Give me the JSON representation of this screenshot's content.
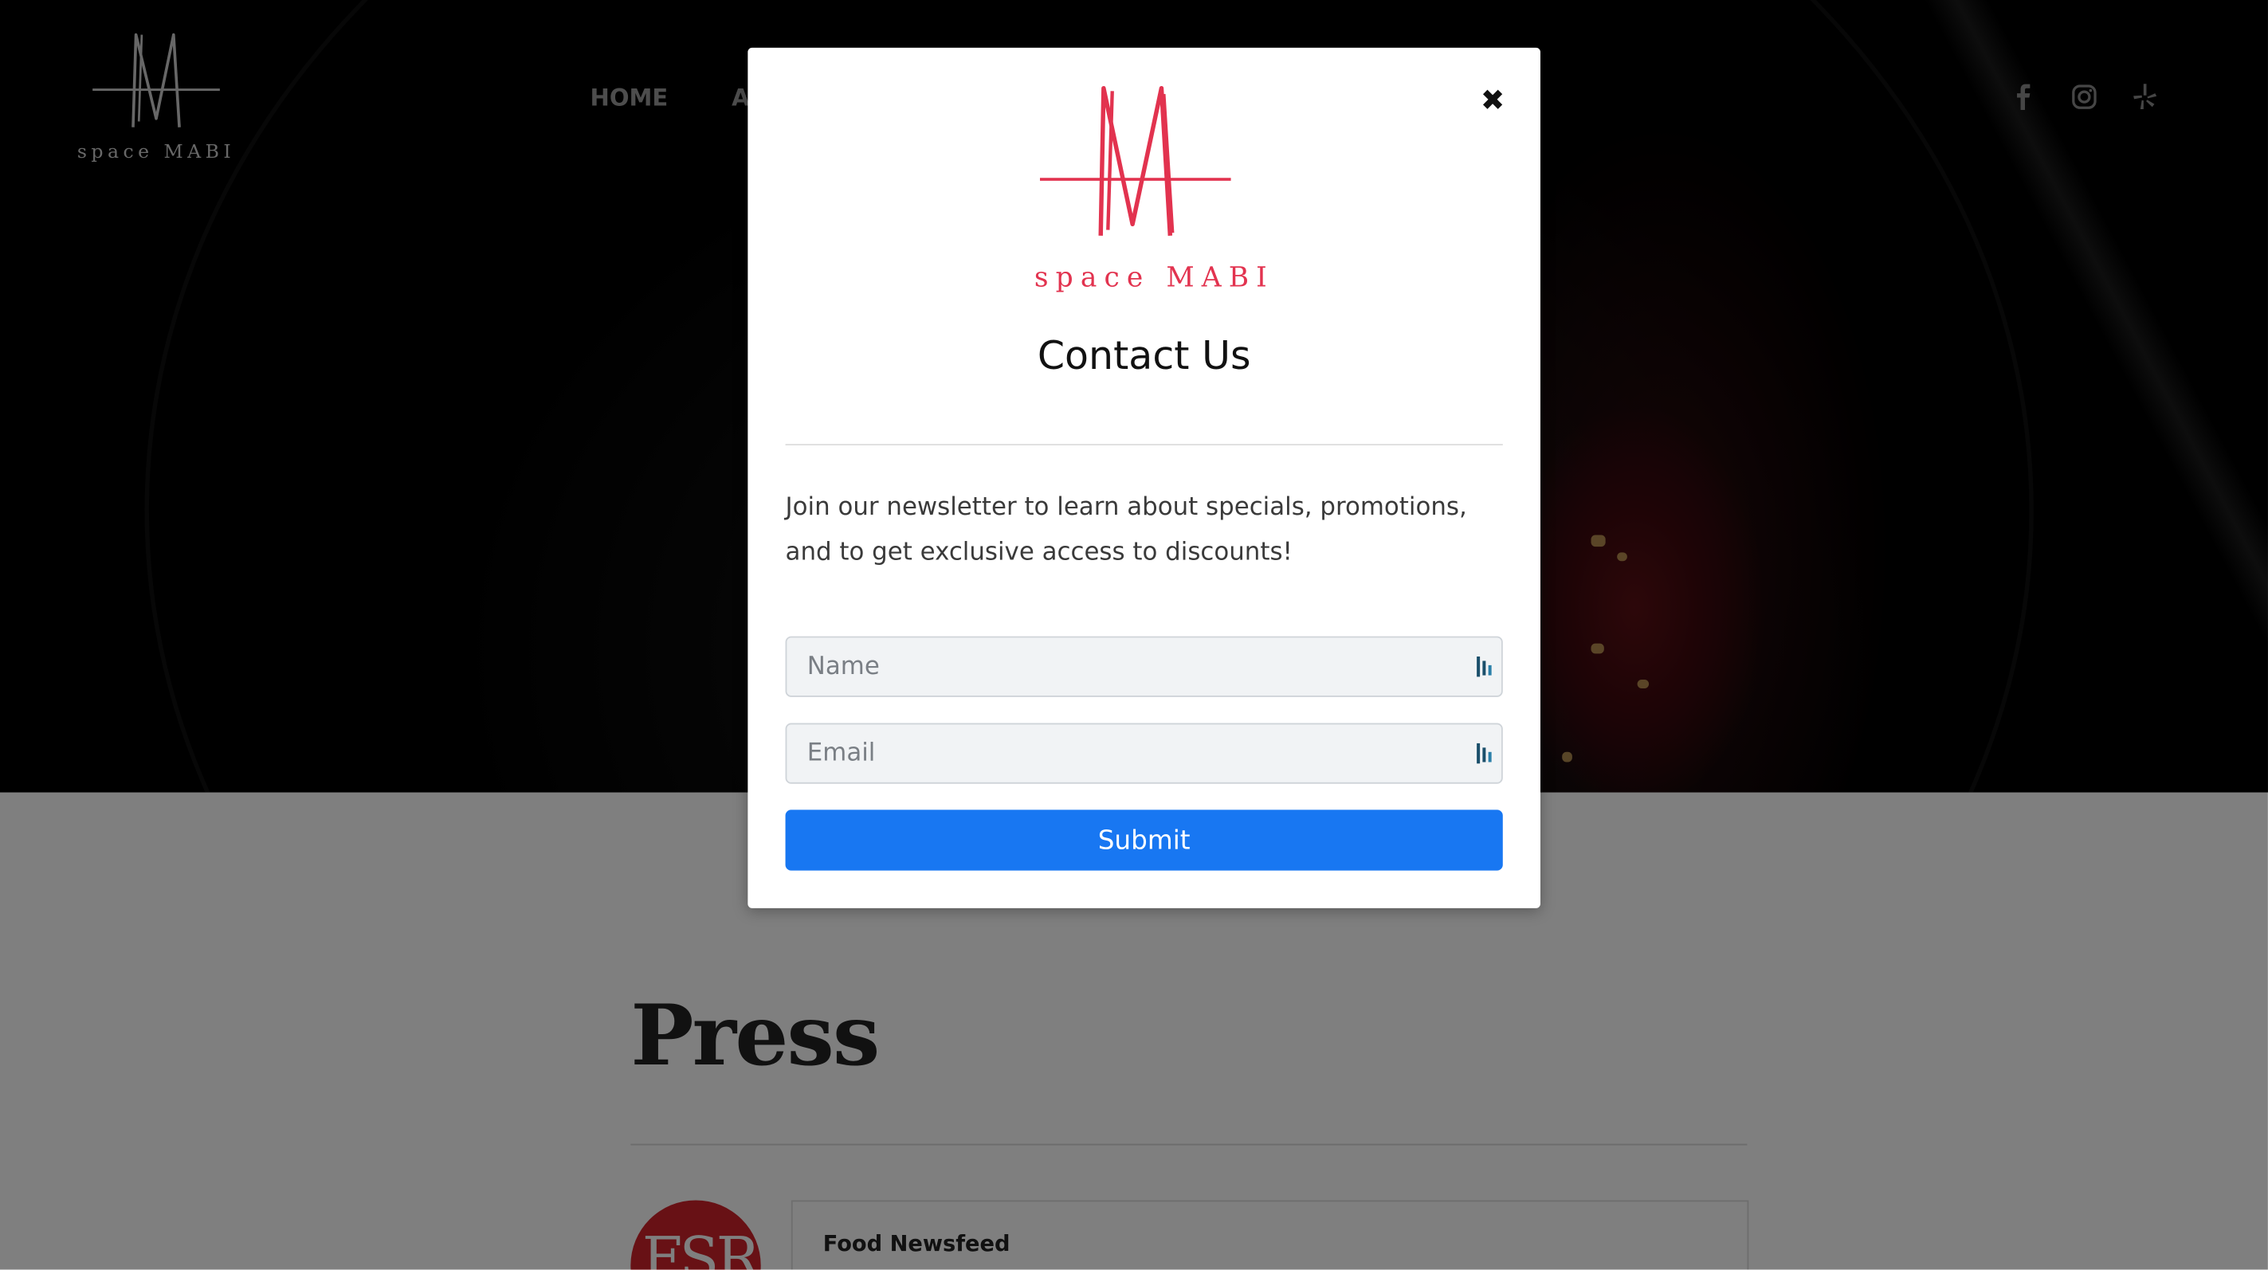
{
  "site": {
    "logo_text": "space MABI",
    "nav": [
      "HOME",
      "AB"
    ]
  },
  "press": {
    "title": "Press",
    "card_title": "Food Newsfeed",
    "avatar_text": "FSR"
  },
  "modal": {
    "logo_text": "space MABI",
    "title": "Contact Us",
    "description": "Join our newsletter to learn about specials, promotions, and to get exclusive access to discounts!",
    "name_placeholder": "Name",
    "email_placeholder": "Email",
    "submit_label": "Submit",
    "close_glyph": "✖"
  },
  "icons": [
    "facebook-icon",
    "instagram-icon",
    "yelp-icon",
    "form-autofill-icon"
  ],
  "colors": {
    "accent_blue": "#1877f2",
    "logo_pink": "#e2334f",
    "overlay": "rgba(0,0,0,0.5)"
  }
}
